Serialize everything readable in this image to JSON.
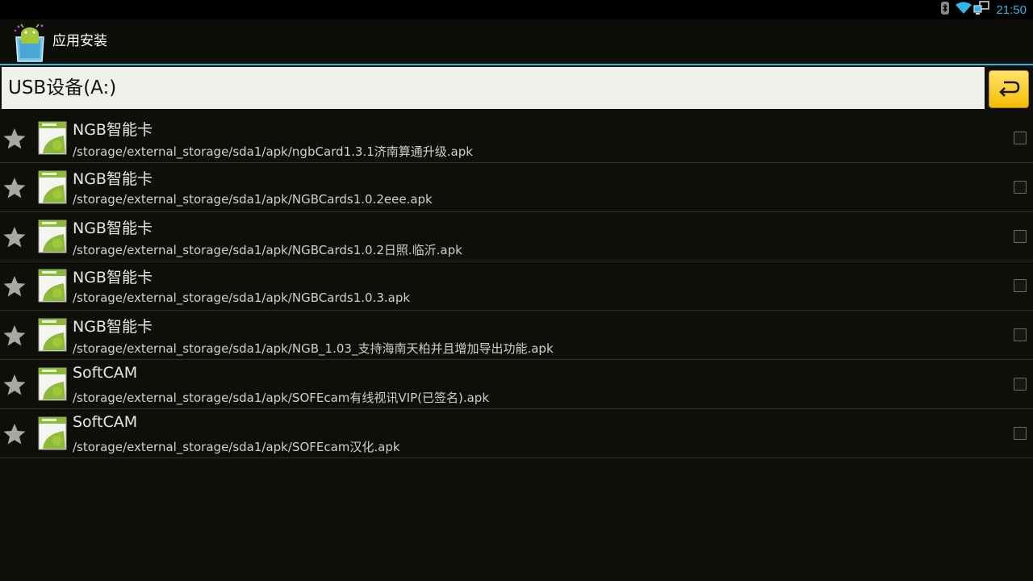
{
  "status_bar": {
    "time": "21:50",
    "icons": [
      "bluetooth-icon",
      "wifi-icon",
      "network-icon"
    ]
  },
  "action_bar": {
    "title": "应用安装",
    "icon": "android-app-installer-icon"
  },
  "path_bar": {
    "current_path": "USB设备(A:)",
    "back_icon": "back-arrow-icon"
  },
  "colors": {
    "accent": "#33b5e5",
    "back_button": "#f5bb05",
    "background": "#0e0e0a"
  },
  "items": [
    {
      "name": "NGB智能卡",
      "path": "/storage/external_storage/sda1/apk/ngbCard1.3.1济南算通升级.apk"
    },
    {
      "name": "NGB智能卡",
      "path": "/storage/external_storage/sda1/apk/NGBCards1.0.2eee.apk"
    },
    {
      "name": "NGB智能卡",
      "path": "/storage/external_storage/sda1/apk/NGBCards1.0.2日照.临沂.apk"
    },
    {
      "name": "NGB智能卡",
      "path": "/storage/external_storage/sda1/apk/NGBCards1.0.3.apk"
    },
    {
      "name": "NGB智能卡",
      "path": "/storage/external_storage/sda1/apk/NGB_1.03_支持海南天柏并且增加导出功能.apk"
    },
    {
      "name": "SoftCAM",
      "path": "/storage/external_storage/sda1/apk/SOFEcam有线视讯VIP(已签名).apk"
    },
    {
      "name": "SoftCAM",
      "path": "/storage/external_storage/sda1/apk/SOFEcam汉化.apk"
    }
  ]
}
